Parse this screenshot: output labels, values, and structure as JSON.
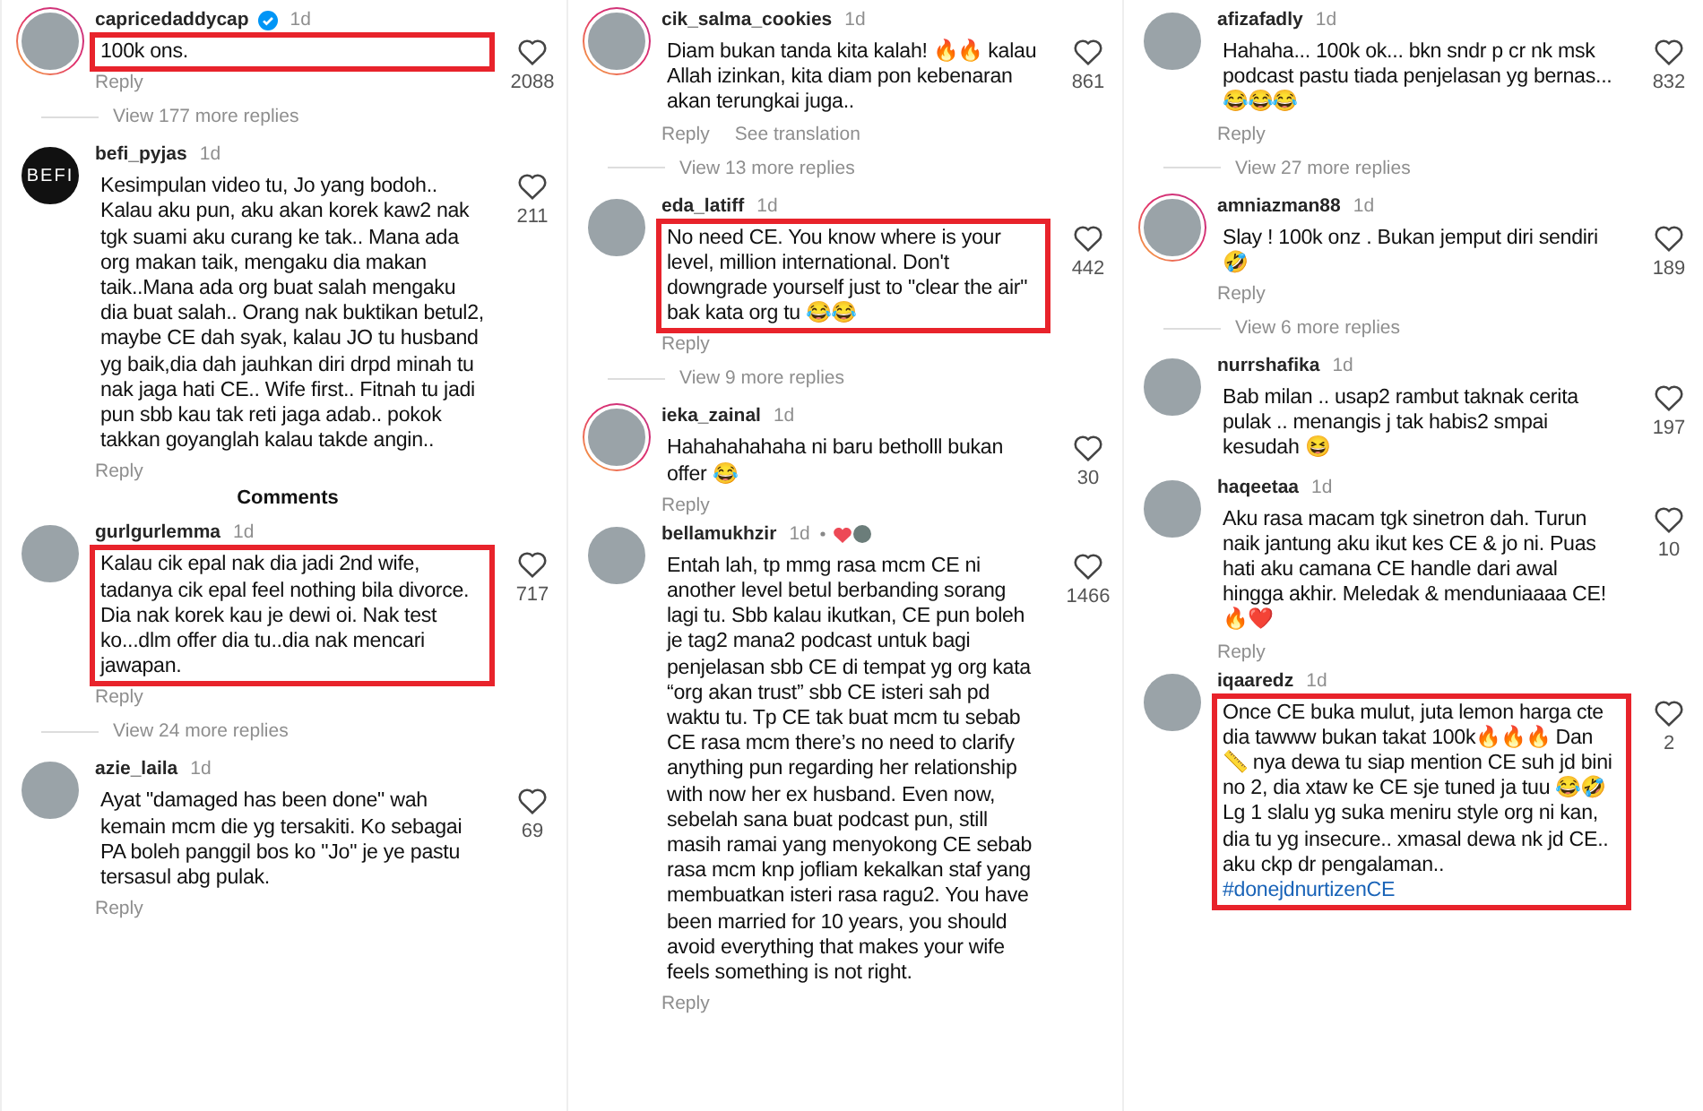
{
  "columns": [
    {
      "items": [
        {
          "kind": "comment",
          "username": "capricedaddycap",
          "verified": true,
          "story_ring": true,
          "time": "1d",
          "text": "100k ons.",
          "highlighted": true,
          "likes": "2088",
          "actions": [
            "Reply"
          ],
          "more_replies": "View 177 more replies"
        },
        {
          "kind": "comment",
          "username": "befi_pyjas",
          "avatar_label": "BEFI",
          "story_ring": false,
          "time": "1d",
          "text": "Kesimpulan video tu, Jo yang bodoh.. Kalau aku pun, aku akan korek kaw2 nak tgk suami aku curang ke tak.. Mana ada org makan taik, mengaku dia makan taik..Mana ada org buat salah mengaku dia buat salah.. Orang nak buktikan betul2, maybe CE dah syak, kalau JO tu husband yg baik,dia dah jauhkan diri drpd minah tu nak jaga hati CE.. Wife first.. Fitnah tu jadi pun sbb kau tak reti jaga adab.. pokok takkan goyanglah kalau takde angin..",
          "highlighted": false,
          "likes": "211",
          "actions": [
            "Reply"
          ]
        },
        {
          "kind": "heading",
          "text": "Comments"
        },
        {
          "kind": "comment",
          "username": "gurlgurlemma",
          "story_ring": false,
          "time": "1d",
          "text": "Kalau cik epal nak dia jadi 2nd wife, tadanya cik epal feel nothing bila divorce. Dia nak korek kau je dewi oi. Nak test ko...dlm offer dia tu..dia nak mencari jawapan.",
          "highlighted": true,
          "likes": "717",
          "actions": [
            "Reply"
          ],
          "more_replies": "View 24 more replies"
        },
        {
          "kind": "comment",
          "username": "azie_laila",
          "story_ring": false,
          "time": "1d",
          "text": "Ayat \"damaged has been done\" wah kemain mcm die yg tersakiti. Ko sebagai PA boleh panggil bos ko \"Jo\" je ye pastu tersasul abg pulak.",
          "highlighted": false,
          "likes": "69",
          "actions": [
            "Reply"
          ]
        }
      ]
    },
    {
      "items": [
        {
          "kind": "comment",
          "username": "cik_salma_cookies",
          "story_ring": true,
          "time": "1d",
          "text": "Diam bukan tanda kita kalah! 🔥🔥 kalau Allah izinkan, kita diam pon kebenaran akan terungkai juga..",
          "highlighted": false,
          "likes": "861",
          "actions": [
            "Reply",
            "See translation"
          ],
          "more_replies": "View 13 more replies"
        },
        {
          "kind": "comment",
          "username": "eda_latiff",
          "story_ring": false,
          "time": "1d",
          "text": "No need CE. You know where is your level, million international. Don't downgrade yourself just to \"clear the air\" bak kata org tu 😂😂",
          "highlighted": true,
          "likes": "442",
          "actions": [
            "Reply"
          ],
          "more_replies": "View 9 more replies"
        },
        {
          "kind": "comment",
          "username": "ieka_zainal",
          "story_ring": true,
          "time": "1d",
          "text": "Hahahahahaha ni baru betholll bukan offer 😂",
          "highlighted": false,
          "likes": "30",
          "actions": [
            "Reply"
          ]
        },
        {
          "kind": "comment",
          "username": "bellamukhzir",
          "story_ring": false,
          "time": "1d",
          "creator_liked": true,
          "text": "Entah lah, tp mmg rasa mcm CE ni another level betul berbanding sorang lagi tu. Sbb kalau ikutkan, CE pun boleh je tag2 mana2 podcast untuk bagi penjelasan sbb CE di tempat yg org kata “org akan trust” sbb CE isteri sah pd waktu tu. Tp CE tak buat mcm tu sebab CE rasa mcm there’s no need to clarify anything pun regarding her relationship with now her ex husband. Even now, sebelah sana buat podcast pun, still masih ramai yang menyokong CE sebab rasa mcm knp jofliam kekalkan staf yang membuatkan isteri rasa ragu2. You have been married for 10 years, you should avoid everything that makes your wife feels something is not right.",
          "highlighted": false,
          "likes": "1466",
          "actions": [
            "Reply"
          ]
        }
      ]
    },
    {
      "items": [
        {
          "kind": "comment",
          "username": "afizafadly",
          "story_ring": false,
          "time": "1d",
          "text": "Hahaha... 100k ok... bkn sndr p cr nk msk podcast pastu tiada penjelasan yg bernas... 😂😂😂",
          "highlighted": false,
          "likes": "832",
          "actions": [
            "Reply"
          ],
          "more_replies": "View 27 more replies"
        },
        {
          "kind": "comment",
          "username": "amniazman88",
          "story_ring": true,
          "time": "1d",
          "text": "Slay ! 100k onz . Bukan jemput diri sendiri 🤣",
          "highlighted": false,
          "likes": "189",
          "actions": [
            "Reply"
          ],
          "more_replies": "View 6 more replies"
        },
        {
          "kind": "comment",
          "username": "nurrshafika",
          "story_ring": false,
          "time": "1d",
          "text": "Bab milan .. usap2 rambut taknak cerita pulak .. menangis j tak habis2 smpai kesudah 😆",
          "highlighted": false,
          "likes": "197"
        },
        {
          "kind": "comment",
          "username": "haqeetaa",
          "story_ring": false,
          "time": "1d",
          "text": "Aku rasa macam tgk sinetron dah. Turun naik jantung aku ikut kes CE & jo ni. Puas hati aku camana CE handle dari awal hingga akhir. Meledak & menduniaaaa CE!🔥❤️",
          "highlighted": false,
          "likes": "10",
          "actions": [
            "Reply"
          ]
        },
        {
          "kind": "comment",
          "username": "iqaaredz",
          "story_ring": false,
          "time": "1d",
          "text": "Once CE buka mulut, juta lemon harga cte dia tawww bukan takat 100k🔥🔥🔥 Dan 📏 nya dewa tu siap mention CE suh jd bini no 2, dia xtaw ke CE sje tuned ja tuu 😂🤣 Lg 1 slalu yg suka meniru style org ni kan, dia tu yg insecure.. xmasal dewa nk jd CE.. aku ckp dr pengalaman..",
          "hashtag": "#donejdnurtizenCE",
          "highlighted": true,
          "likes": "2"
        }
      ]
    }
  ]
}
